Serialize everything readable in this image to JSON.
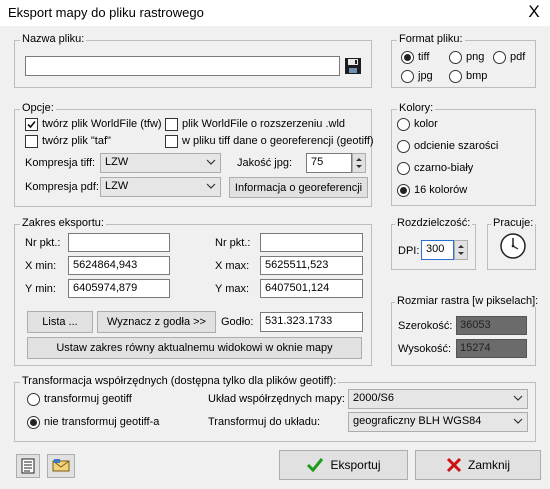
{
  "window": {
    "title": "Eksport mapy do pliku rastrowego",
    "close_glyph": "X"
  },
  "filename": {
    "legend": "Nazwa pliku:",
    "value": "",
    "save_icon": "floppy-disk-icon"
  },
  "format": {
    "legend": "Format pliku:",
    "options": [
      "tiff",
      "png",
      "pdf",
      "jpg",
      "bmp"
    ],
    "selected": "tiff"
  },
  "options": {
    "legend": "Opcje:",
    "checks": [
      {
        "label": "twórz plik WorldFile (tfw)",
        "checked": true
      },
      {
        "label": "twórz plik \"taf\"",
        "checked": false
      },
      {
        "label": "plik WorldFile o rozszerzeniu .wld",
        "checked": false
      },
      {
        "label": "w pliku tiff dane o georeferencji (geotiff)",
        "checked": false
      }
    ],
    "tiff_compression_label": "Kompresja tiff:",
    "tiff_compression_value": "LZW",
    "pdf_compression_label": "Kompresja pdf:",
    "pdf_compression_value": "LZW",
    "jpg_quality_label": "Jakość jpg:",
    "jpg_quality_value": "75",
    "georef_button": "Informacja o georeferencji"
  },
  "colors": {
    "legend": "Kolory:",
    "options": [
      "kolor",
      "odcienie szarości",
      "czarno-biały",
      "16 kolorów"
    ],
    "selected": "16 kolorów"
  },
  "extent": {
    "legend": "Zakres eksportu:",
    "nr_label": "Nr pkt.:",
    "nr_left": "",
    "nr_right": "",
    "xmin_label": "X min:",
    "xmin": "5624864,943",
    "xmax_label": "X max:",
    "xmax": "5625511,523",
    "ymin_label": "Y min:",
    "ymin": "6405974,879",
    "ymax_label": "Y max:",
    "ymax": "6407501,124",
    "list_button": "Lista ...",
    "godlo_button": "Wyznacz z godła >>",
    "godlo_label": "Godło:",
    "godlo_value": "531.323.1733",
    "set_view_button": "Ustaw zakres równy aktualnemu widokowi w oknie mapy"
  },
  "resolution": {
    "legend": "Rozdzielczość:",
    "dpi_label": "DPI:",
    "dpi_value": "300"
  },
  "working": {
    "legend": "Pracuje:",
    "icon": "clock-icon"
  },
  "raster_size": {
    "legend": "Rozmiar rastra [w pikselach]:",
    "width_label": "Szerokość:",
    "width_value": "36053",
    "height_label": "Wysokość:",
    "height_value": "15274"
  },
  "transform": {
    "legend": "Transformacja współrzędnych (dostępna tylko dla plików geotiff):",
    "options": [
      "transformuj geotiff",
      "nie transformuj geotiff-a"
    ],
    "selected": "nie transformuj geotiff-a",
    "coord_system_label": "Układ współrzędnych mapy:",
    "coord_system_value": "2000/S6",
    "target_label": "Transformuj do układu:",
    "target_value": "geograficzny BLH WGS84"
  },
  "footer": {
    "export_button": "Eksportuj",
    "close_button": "Zamknij",
    "doc_icon": "document-icon",
    "mail_icon": "envelope-icon"
  },
  "colors_theme": {
    "accent_check": "#1e9c1e",
    "accent_x": "#cc1111",
    "readonly_bg": "#6b6b6b"
  }
}
